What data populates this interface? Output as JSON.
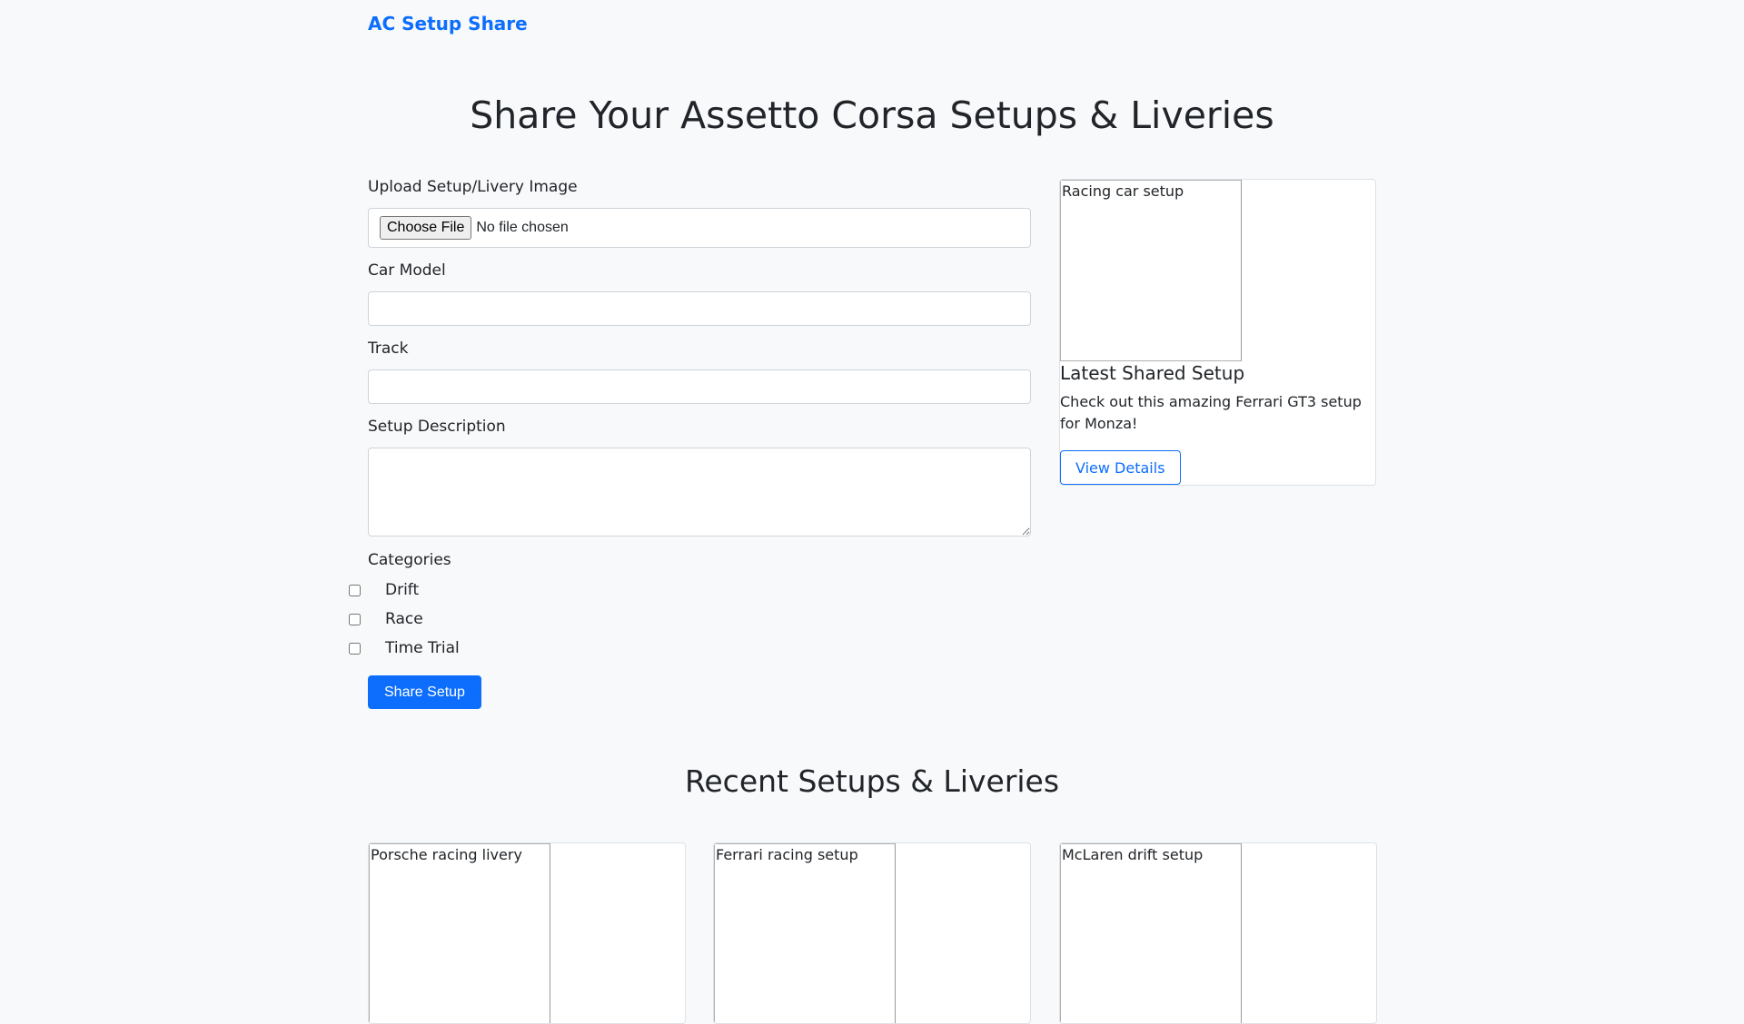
{
  "header": {
    "brand": "AC Setup Share"
  },
  "hero": {
    "title": "Share Your Assetto Corsa Setups & Liveries"
  },
  "form": {
    "upload_label": "Upload Setup/Livery Image",
    "file_button": "Choose File",
    "file_status": "No file chosen",
    "car_model_label": "Car Model",
    "car_model_value": "",
    "track_label": "Track",
    "track_value": "",
    "description_label": "Setup Description",
    "description_value": "",
    "categories_label": "Categories",
    "categories": [
      {
        "label": "Drift",
        "checked": false
      },
      {
        "label": "Race",
        "checked": false
      },
      {
        "label": "Time Trial",
        "checked": false
      }
    ],
    "submit_label": "Share Setup"
  },
  "latest": {
    "image_alt": "Racing car setup",
    "title": "Latest Shared Setup",
    "text": "Check out this amazing Ferrari GT3 setup for Monza!",
    "button": "View Details"
  },
  "recent": {
    "title": "Recent Setups & Liveries",
    "items": [
      {
        "image_alt": "Porsche racing livery"
      },
      {
        "image_alt": "Ferrari racing setup"
      },
      {
        "image_alt": "McLaren drift setup"
      }
    ]
  },
  "colors": {
    "primary": "#0d6efd",
    "background": "#f8f9fa",
    "text": "#212529"
  }
}
